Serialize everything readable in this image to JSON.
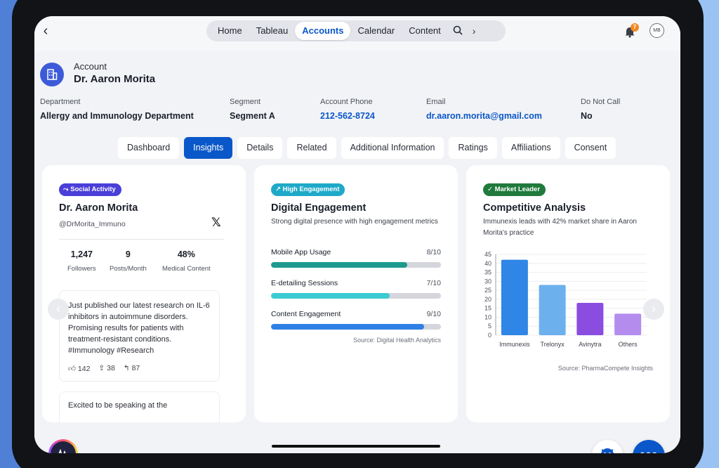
{
  "nav": {
    "items": [
      "Home",
      "Tableau",
      "Accounts",
      "Calendar",
      "Content"
    ],
    "active": "Accounts",
    "notification_count": "7",
    "avatar_initials": "MB"
  },
  "account": {
    "kicker": "Account",
    "name": "Dr. Aaron Morita",
    "fields": [
      {
        "label": "Department",
        "value": "Allergy and Immunology Department",
        "link": false
      },
      {
        "label": "Segment",
        "value": "Segment A",
        "link": false
      },
      {
        "label": "Account Phone",
        "value": "212-562-8724",
        "link": true
      },
      {
        "label": "Email",
        "value": "dr.aaron.morita@gmail.com",
        "link": true
      },
      {
        "label": "Do Not Call",
        "value": "No",
        "link": false
      }
    ]
  },
  "tabs": [
    "Dashboard",
    "Insights",
    "Details",
    "Related",
    "Additional Information",
    "Ratings",
    "Affiliations",
    "Consent"
  ],
  "active_tab": "Insights",
  "social": {
    "chip": "Social Activity",
    "chip_color": "#4a3fd8",
    "name": "Dr. Aaron Morita",
    "handle": "@DrMorita_Immuno",
    "platform_icon": "x-logo-icon",
    "stats": [
      {
        "value": "1,247",
        "label": "Followers"
      },
      {
        "value": "9",
        "label": "Posts/Month"
      },
      {
        "value": "48%",
        "label": "Medical Content"
      }
    ],
    "post": {
      "text": "Just published our latest research on IL-6 inhibitors in autoimmune disorders. Promising results for patients with treatment-resistant conditions. #Immunology #Research",
      "likes": "142",
      "shares": "38",
      "replies": "87"
    },
    "post2_text": "Excited to be speaking at the"
  },
  "engagement": {
    "chip": "High Engagement",
    "chip_color": "#1fa9c9",
    "title": "Digital Engagement",
    "description": "Strong digital presence with high engagement metrics",
    "metrics": [
      {
        "label": "Mobile App Usage",
        "score": "8/10",
        "value": 0.8,
        "color": "#1e9a8e"
      },
      {
        "label": "E-detailing Sessions",
        "score": "7/10",
        "value": 0.7,
        "color": "#3ccbd2"
      },
      {
        "label": "Content Engagement",
        "score": "9/10",
        "value": 0.9,
        "color": "#2f7fe6"
      }
    ],
    "source": "Source: Digital Health Analytics"
  },
  "competitive": {
    "chip": "Market Leader",
    "chip_color": "#1f7a3c",
    "title": "Competitive Analysis",
    "description": "Immunexis leads with 42% market share in Aaron Morita's practice",
    "source": "Source: PharmaCompete Insights"
  },
  "chart_data": {
    "type": "bar",
    "categories": [
      "Immunexis",
      "Trelonyx",
      "Avinytra",
      "Others"
    ],
    "values": [
      42,
      28,
      18,
      12
    ],
    "colors": [
      "#2f86e6",
      "#6cb0ee",
      "#8a4de0",
      "#b48cee"
    ],
    "ylim": [
      0,
      45
    ],
    "yticks": [
      0,
      5,
      10,
      15,
      20,
      25,
      30,
      35,
      40,
      45
    ],
    "title": "",
    "xlabel": "",
    "ylabel": ""
  }
}
